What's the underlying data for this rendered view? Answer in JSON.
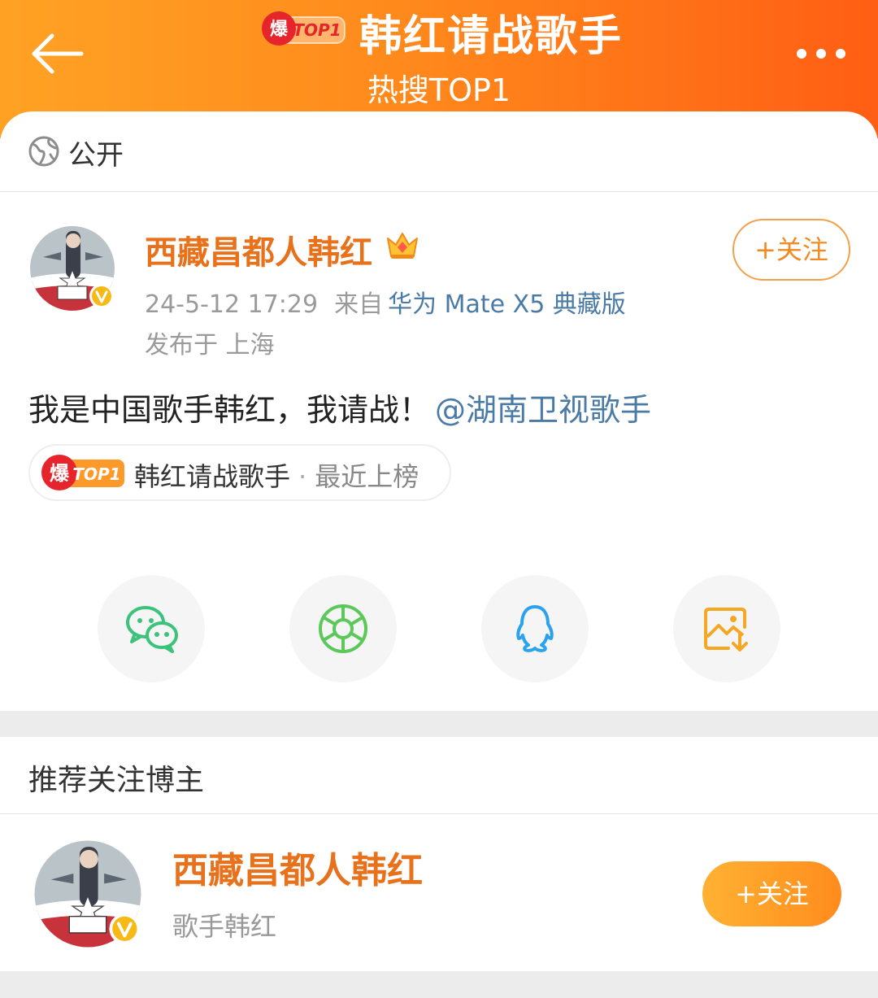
{
  "header": {
    "badge_char": "爆",
    "badge_rank": "TOP1",
    "title": "韩红请战歌手",
    "subtitle": "热搜TOP1"
  },
  "visibility": {
    "label": "公开"
  },
  "post": {
    "author": "西藏昌都人韩红",
    "follow_label": "+关注",
    "time": "24-5-12 17:29",
    "source_prefix": "来自",
    "device": "华为 Mate X5 典藏版",
    "location": "发布于 上海",
    "text": "我是中国歌手韩红，我请战！",
    "mention": "@湖南卫视歌手"
  },
  "topic_chip": {
    "badge_char": "爆",
    "badge_rank": "TOP1",
    "topic": "韩红请战歌手",
    "separator": "·",
    "status": "最近上榜"
  },
  "share": [
    {
      "icon": "wechat-icon",
      "color": "#3bc27b"
    },
    {
      "icon": "moments-icon",
      "color": "#5cc85a"
    },
    {
      "icon": "qq-icon",
      "color": "#2aa3ec"
    },
    {
      "icon": "save-image-icon",
      "color": "#f5a623"
    }
  ],
  "recommend": {
    "title": "推荐关注博主",
    "name": "西藏昌都人韩红",
    "desc": "歌手韩红",
    "follow_label": "+关注"
  },
  "colors": {
    "brand_orange": "#ff8a1c",
    "name_orange": "#e8711c",
    "link_blue": "#4a7aa6",
    "badge_red": "#e6242b"
  }
}
